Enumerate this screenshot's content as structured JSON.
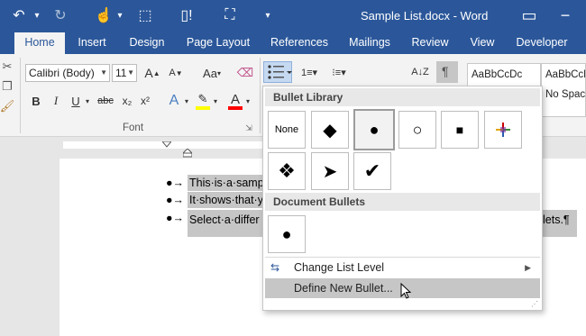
{
  "window": {
    "title": "Sample List.docx - Word"
  },
  "quick_access": {
    "undo_icon": "undo-icon",
    "redo_icon": "redo-icon",
    "touch_icon": "touch-mode-icon",
    "select_icon": "select-icon",
    "new_comment_icon": "new-comment-icon",
    "share_icon": "org-chart-icon",
    "customize_icon": "customize-qat-icon"
  },
  "window_controls": {
    "restore": "▭",
    "minimize": "−",
    "close": "✕"
  },
  "tabs": [
    "Home",
    "Insert",
    "Design",
    "Page Layout",
    "References",
    "Mailings",
    "Review",
    "View",
    "Developer"
  ],
  "ribbon": {
    "font_name": "Calibri (Body)",
    "font_size": "11",
    "grow_font": "A",
    "shrink_font": "A",
    "case_label": "Aa",
    "bold": "B",
    "italic": "I",
    "underline": "U",
    "strike": "abc",
    "subscript": "x₂",
    "superscript": "x²",
    "font_group": "Font",
    "sort_label": "A↓Z",
    "pilcrow": "¶",
    "styles": [
      "AaBbCcDc",
      "AaBbCcDc"
    ],
    "style_names": [
      "",
      "No Spac"
    ]
  },
  "dropdown": {
    "bullet_library_label": "Bullet Library",
    "none_label": "None",
    "library_bullets": [
      "◆",
      "●",
      "○",
      "■",
      "✦",
      "❖",
      "➤",
      "✔"
    ],
    "document_bullets_label": "Document Bullets",
    "document_bullets": [
      "●"
    ],
    "change_level_label": "Change List Level",
    "define_new_label": "Define New Bullet..."
  },
  "document": {
    "lines": [
      {
        "bullet": "●→",
        "text": "This·is·a·samp"
      },
      {
        "bullet": "●→",
        "text": "It·shows·that·y"
      },
      {
        "bullet": "●→",
        "text": "Select·a·differ"
      }
    ],
    "line3_tail": "lets.¶"
  },
  "colors": {
    "brand": "#2b579a",
    "highlight": "#ffff00",
    "font_color": "#ff0000",
    "selection": "#c6c6c6"
  }
}
